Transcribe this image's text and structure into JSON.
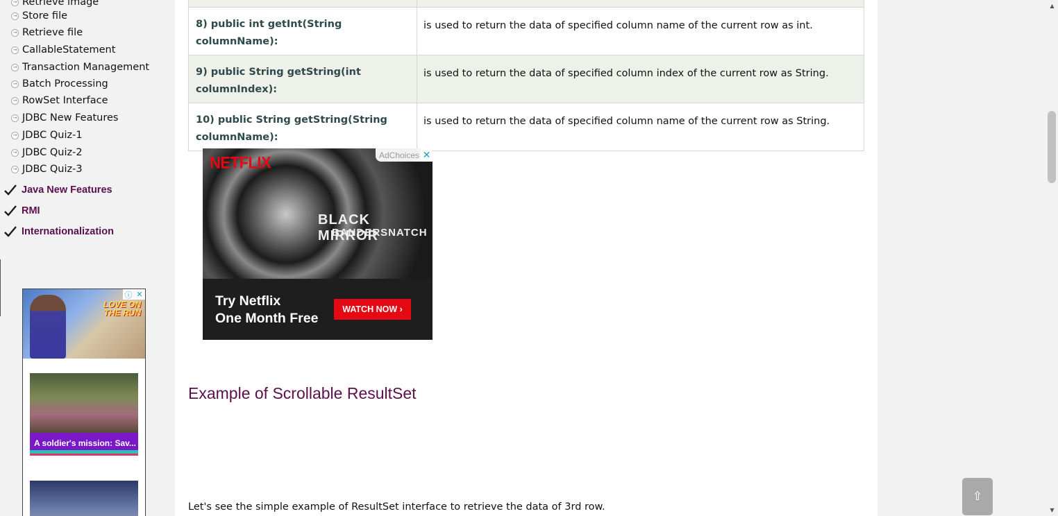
{
  "sidebar": {
    "items": [
      {
        "label": "Retrieve image"
      },
      {
        "label": "Store file"
      },
      {
        "label": "Retrieve file"
      },
      {
        "label": "CallableStatement"
      },
      {
        "label": "Transaction Management"
      },
      {
        "label": "Batch Processing"
      },
      {
        "label": "RowSet Interface"
      },
      {
        "label": "JDBC New Features"
      },
      {
        "label": "JDBC Quiz-1"
      },
      {
        "label": "JDBC Quiz-2"
      },
      {
        "label": "JDBC Quiz-3"
      }
    ],
    "groups": [
      {
        "label": "Java New Features"
      },
      {
        "label": "RMI"
      },
      {
        "label": "Internationalization"
      }
    ]
  },
  "side_ad": {
    "banner_text": "LOVE ON THE RUN",
    "card1_caption": "A soldier's mission: Sav..."
  },
  "methods_table": {
    "rows": [
      {
        "method": "8) public int getInt(String columnName):",
        "desc": "is used to return the data of specified column name of the current row as int."
      },
      {
        "method": "9) public String getString(int columnIndex):",
        "desc": "is used to return the data of specified column index of the current row as String."
      },
      {
        "method": "10) public String getString(String columnName):",
        "desc": "is used to return the data of specified column name of the current row as String."
      }
    ]
  },
  "netflix_ad": {
    "brand": "NETFLIX",
    "show_title_1": "BLACK MIRROR",
    "show_title_2": "BANDERSNATCH",
    "adchoices": "AdChoices",
    "tagline_1": "Try Netflix",
    "tagline_2": "One Month Free",
    "cta": "WATCH NOW ›"
  },
  "content": {
    "heading": "Example of Scrollable ResultSet",
    "intro": "Let's see the simple example of ResultSet interface to retrieve the data of 3rd row."
  },
  "scroll_top": {
    "label": "⇧"
  }
}
